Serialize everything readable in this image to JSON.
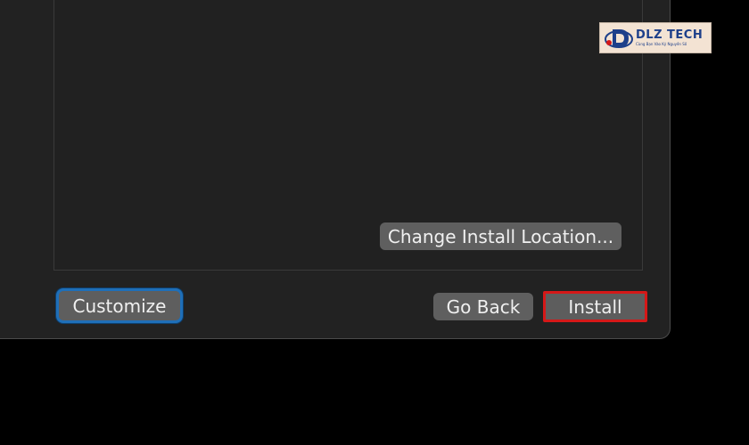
{
  "installer": {
    "change_location_label": "Change Install Location...",
    "customize_label": "Customize",
    "go_back_label": "Go Back",
    "install_label": "Install"
  },
  "watermark": {
    "brand": "DLZ TECH",
    "tagline": "Cùng Bạn Vào Kỷ Nguyên Số"
  },
  "colors": {
    "window_background": "#222222",
    "button_background": "#5f5f5f",
    "focus_ring": "#1f6fb8",
    "highlight_box": "#d51818"
  }
}
